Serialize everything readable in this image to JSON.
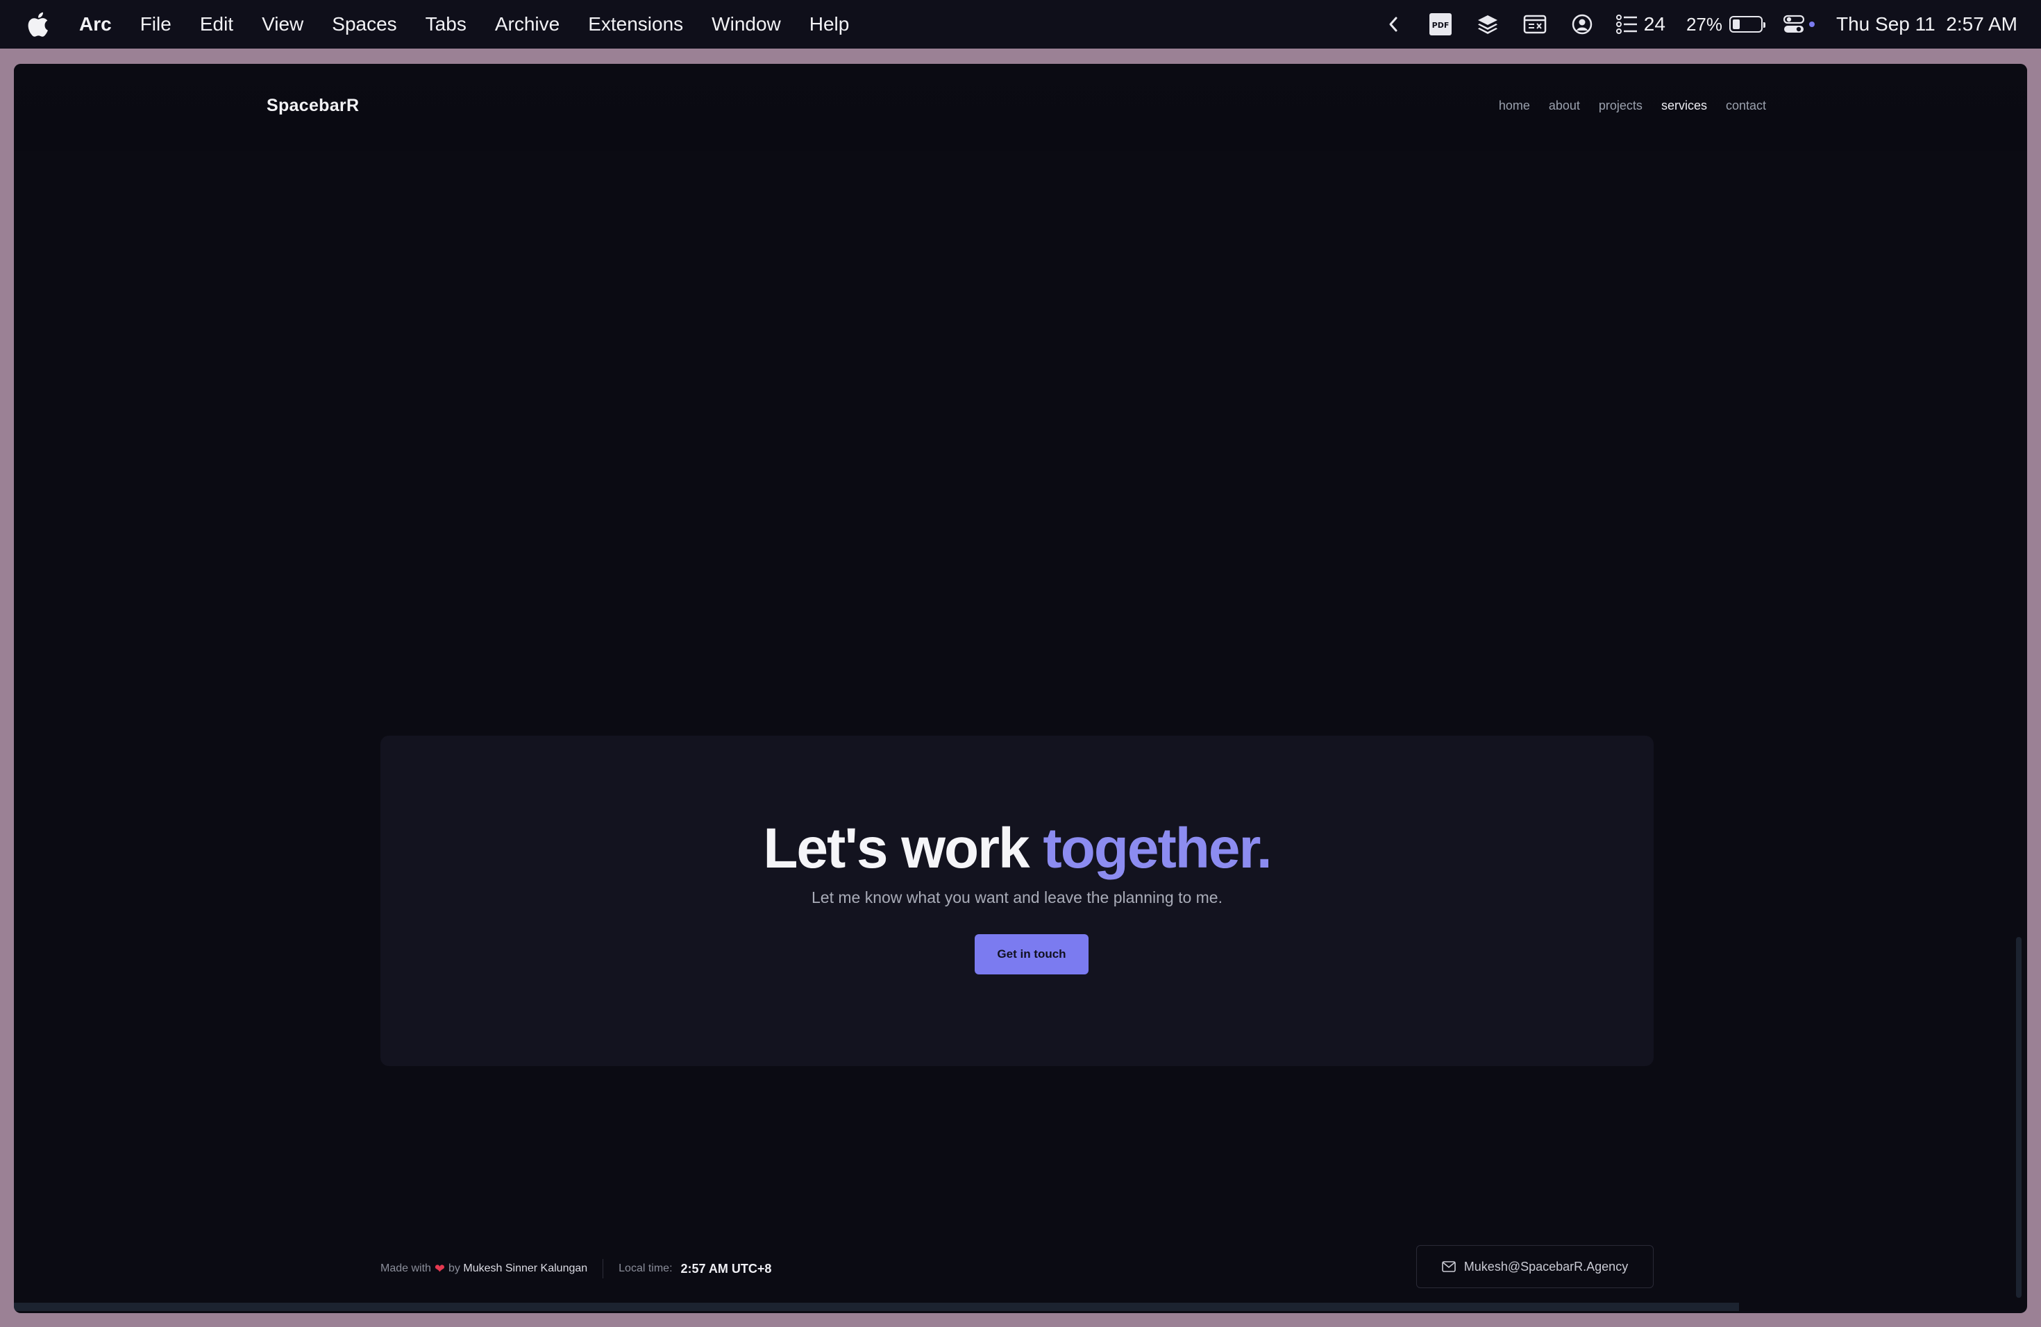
{
  "menubar": {
    "app_name": "Arc",
    "items": [
      "File",
      "Edit",
      "View",
      "Spaces",
      "Tabs",
      "Archive",
      "Extensions",
      "Window",
      "Help"
    ],
    "tray": {
      "pdf_label": "PDF",
      "reminders_count": "24",
      "battery_percent": "27%",
      "battery_level": 0.27,
      "date": "Thu Sep 11",
      "time": "2:57 AM"
    }
  },
  "site": {
    "brand": "SpacebarR",
    "nav": [
      {
        "label": "home"
      },
      {
        "label": "about"
      },
      {
        "label": "projects"
      },
      {
        "label": "services"
      },
      {
        "label": "contact"
      }
    ],
    "active_nav": "services",
    "cta": {
      "title_main": "Let's work ",
      "title_accent": "together.",
      "subtitle": "Let me know what you want and leave the planning to me.",
      "button": "Get in touch"
    },
    "footer": {
      "made_with": "Made with",
      "by": "by",
      "author": "Mukesh Sinner Kalungan",
      "local_time_label": "Local time:",
      "local_time": "2:57 AM UTC+8",
      "email": "Mukesh@SpacebarR.Agency"
    },
    "colors": {
      "accent": "#8c8cf0",
      "button": "#7b7bf0",
      "background": "#0b0b13",
      "card": "#13131f"
    }
  }
}
